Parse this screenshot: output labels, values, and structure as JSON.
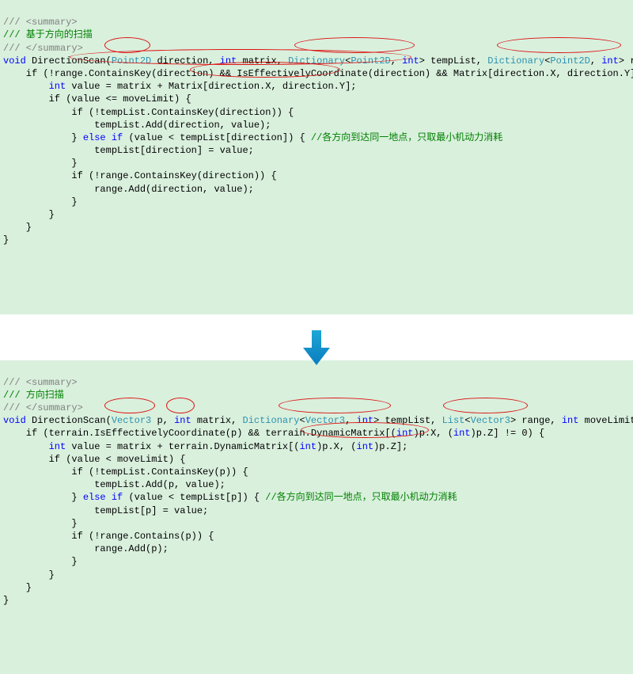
{
  "block1": {
    "l1": "/// <summary>",
    "l2": "/// 基于方向的扫描",
    "l3": "/// </summary>",
    "kw_void": "void",
    "fn": "DirectionScan",
    "t_point2d_a": "Point2D",
    "p_dir": " direction, ",
    "kw_int_a": "int",
    "p_matrix": " matrix, ",
    "t_dict_a": "Dictionary",
    "t_point2d_b": "Point2D",
    "comma1": ", ",
    "kw_int_b": "int",
    "gt1": ">",
    "p_templist": " tempList, ",
    "t_dict_b": "Dictionary",
    "t_point2d_c": "Point2D",
    "comma2": ", ",
    "kw_int_c": "int",
    "gt2": ">",
    "p_range_tail": " ran",
    "l5_a": "    if (!range.ContainsKey(direction) && ",
    "l5_fn": "IsEffectivelyCoordinate",
    "l5_b": "(direction) && Matrix[direction.X, direction.Y] !",
    "l6_a": "        ",
    "kw_int_d": "int",
    "l6_b": " value = matrix + Matrix[",
    "l6_c": "direction.X, direction.Y",
    "l6_d": "];",
    "l7": "        if (value <= moveLimit) {",
    "l8": "            if (!tempList.ContainsKey(direction)) {",
    "l9": "                tempList.Add(direction, value);",
    "l10a": "            } ",
    "kw_else1": "else",
    "l10b": " ",
    "kw_if1": "if",
    "l10c": " (value < tempList[direction]) { ",
    "l10cmt": "//各方向到达同一地点，只取最小机动力消耗",
    "l11": "                tempList[direction] = value;",
    "l12": "            }",
    "l13": "            if (!range.ContainsKey(direction)) {",
    "l14": "                range.Add(direction, value);",
    "l15": "            }",
    "l16": "        }",
    "l17": "    }",
    "l18": "}"
  },
  "block2": {
    "l1": "/// <summary>",
    "l2": "/// 方向扫描",
    "l3": "/// </summary>",
    "kw_void": "void",
    "fn": "DirectionScan",
    "t_vec3_a": "Vector3",
    "p_p": " p, ",
    "kw_int_a": "int",
    "p_matrix": " matrix, ",
    "t_dict": "Dictionary",
    "t_vec3_b": "Vector3",
    "comma1": ", ",
    "kw_int_b": "int",
    "gt1": ">",
    "p_templist": " tempList, ",
    "t_list": "List",
    "t_vec3_c": "Vector3",
    "gt2": ">",
    "p_range": " range, ",
    "kw_int_c": "int",
    "p_movelimit": " moveLimit) ",
    "l5_a": "    if (terrain.IsEffectivelyCoordinate(p) && terrain.DynamicMatrix[(",
    "kw_int_d": "int",
    "l5_b": ")p.X, (",
    "kw_int_e": "int",
    "l5_c": ")p.Z] != 0) {",
    "l6_a": "        ",
    "kw_int_f": "int",
    "l6_b": " value = matrix + terrain.DynamicMatrix[(",
    "kw_int_g": "int",
    "l6_c": ")p.X, (",
    "kw_int_h": "int",
    "l6_d": ")p.Z];",
    "l7": "        if (value < moveLimit) {",
    "l8": "            if (!tempList.ContainsKey(p)) {",
    "l9": "                tempList.Add(p, value);",
    "l10a": "            } ",
    "kw_else1": "else",
    "l10b": " ",
    "kw_if1": "if",
    "l10c": " (value < tempList[p]) { ",
    "l10cmt": "//各方向到达同一地点，只取最小机动力消耗",
    "l11": "                tempList[p] = value;",
    "l12": "            }",
    "l13": "            if (!range.Contains(p)) {",
    "l14": "                range.Add(p);",
    "l15": "            }",
    "l16": "        }",
    "l17": "    }",
    "l18": "}"
  }
}
